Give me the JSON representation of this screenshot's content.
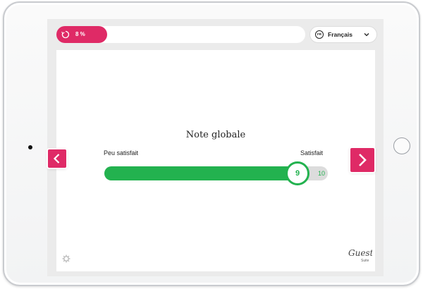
{
  "header": {
    "progress": {
      "percent_label": "8 %",
      "value": 0.08
    },
    "language": {
      "code": "FR",
      "selected": "Français"
    }
  },
  "question": {
    "title": "Note globale",
    "low_label": "Peu satisfait",
    "high_label": "Satisfait",
    "value": 9,
    "max": 10,
    "value_label": "9",
    "max_label": "10"
  },
  "branding": {
    "logo_text": "Guest",
    "logo_subtext": "Suite"
  },
  "colors": {
    "accent": "#df2a66",
    "slider": "#23b24f",
    "screen_bg": "#ebebeb",
    "card_bg": "#ffffff"
  },
  "icons": {
    "progress": "refresh-icon",
    "language": "chat-bubble-icon",
    "dropdown": "chevron-down-icon",
    "prev": "chevron-left-icon",
    "next": "chevron-right-icon",
    "settings": "gear-icon"
  }
}
